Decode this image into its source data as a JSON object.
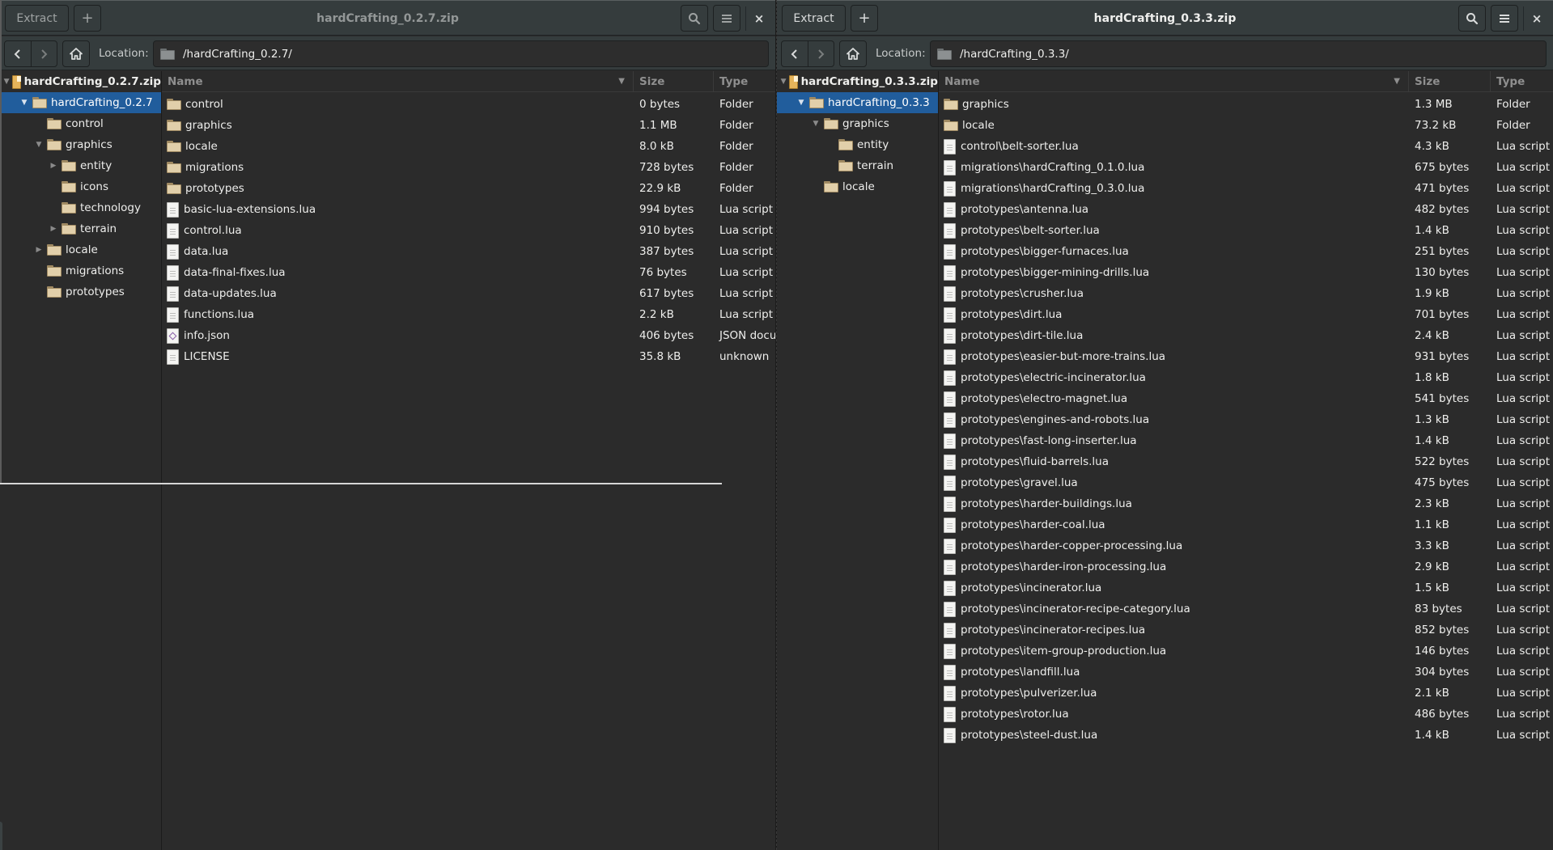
{
  "left_window": {
    "title": "hardCrafting_0.2.7.zip",
    "active": false,
    "toolbar": {
      "extract_label": "Extract",
      "add_label": "+",
      "search_icon": "search-icon",
      "menu_icon": "hamburger-menu-icon",
      "close_label": "×"
    },
    "location": {
      "label": "Location:",
      "path": "/hardCrafting_0.2.7/"
    },
    "tree": [
      {
        "label": "hardCrafting_0.2.7.zip",
        "depth": 0,
        "expander": "expanded",
        "icon": "archive-icon",
        "root": true
      },
      {
        "label": "hardCrafting_0.2.7",
        "depth": 1,
        "expander": "expanded",
        "icon": "folder-icon",
        "selected": true
      },
      {
        "label": "control",
        "depth": 2,
        "expander": "none",
        "icon": "folder-icon"
      },
      {
        "label": "graphics",
        "depth": 2,
        "expander": "expanded",
        "icon": "folder-icon"
      },
      {
        "label": "entity",
        "depth": 3,
        "expander": "collapsed",
        "icon": "folder-icon"
      },
      {
        "label": "icons",
        "depth": 3,
        "expander": "none",
        "icon": "folder-icon"
      },
      {
        "label": "technology",
        "depth": 3,
        "expander": "none",
        "icon": "folder-icon"
      },
      {
        "label": "terrain",
        "depth": 3,
        "expander": "collapsed",
        "icon": "folder-icon"
      },
      {
        "label": "locale",
        "depth": 2,
        "expander": "collapsed",
        "icon": "folder-icon"
      },
      {
        "label": "migrations",
        "depth": 2,
        "expander": "none",
        "icon": "folder-icon"
      },
      {
        "label": "prototypes",
        "depth": 2,
        "expander": "none",
        "icon": "folder-icon"
      }
    ],
    "columns": {
      "name": "Name",
      "size": "Size",
      "type": "Type"
    },
    "files": [
      {
        "name": "control",
        "size": "0 bytes",
        "type": "Folder",
        "icon": "folder"
      },
      {
        "name": "graphics",
        "size": "1.1 MB",
        "type": "Folder",
        "icon": "folder"
      },
      {
        "name": "locale",
        "size": "8.0 kB",
        "type": "Folder",
        "icon": "folder"
      },
      {
        "name": "migrations",
        "size": "728 bytes",
        "type": "Folder",
        "icon": "folder"
      },
      {
        "name": "prototypes",
        "size": "22.9 kB",
        "type": "Folder",
        "icon": "folder"
      },
      {
        "name": "basic-lua-extensions.lua",
        "size": "994 bytes",
        "type": "Lua script",
        "icon": "file"
      },
      {
        "name": "control.lua",
        "size": "910 bytes",
        "type": "Lua script",
        "icon": "file"
      },
      {
        "name": "data.lua",
        "size": "387 bytes",
        "type": "Lua script",
        "icon": "file"
      },
      {
        "name": "data-final-fixes.lua",
        "size": "76 bytes",
        "type": "Lua script",
        "icon": "file"
      },
      {
        "name": "data-updates.lua",
        "size": "617 bytes",
        "type": "Lua script",
        "icon": "file"
      },
      {
        "name": "functions.lua",
        "size": "2.2 kB",
        "type": "Lua script",
        "icon": "file"
      },
      {
        "name": "info.json",
        "size": "406 bytes",
        "type": "JSON document",
        "icon": "json"
      },
      {
        "name": "LICENSE",
        "size": "35.8 kB",
        "type": "unknown",
        "icon": "file"
      }
    ]
  },
  "right_window": {
    "title": "hardCrafting_0.3.3.zip",
    "active": true,
    "toolbar": {
      "extract_label": "Extract",
      "add_label": "+",
      "search_icon": "search-icon",
      "menu_icon": "hamburger-menu-icon",
      "close_label": "×"
    },
    "location": {
      "label": "Location:",
      "path": "/hardCrafting_0.3.3/"
    },
    "tree": [
      {
        "label": "hardCrafting_0.3.3.zip",
        "depth": 0,
        "expander": "expanded",
        "icon": "archive-icon",
        "root": true
      },
      {
        "label": "hardCrafting_0.3.3",
        "depth": 1,
        "expander": "expanded",
        "icon": "folder-icon",
        "selected": true
      },
      {
        "label": "graphics",
        "depth": 2,
        "expander": "expanded",
        "icon": "folder-icon"
      },
      {
        "label": "entity",
        "depth": 3,
        "expander": "none",
        "icon": "folder-icon"
      },
      {
        "label": "terrain",
        "depth": 3,
        "expander": "none",
        "icon": "folder-icon"
      },
      {
        "label": "locale",
        "depth": 2,
        "expander": "none",
        "icon": "folder-icon"
      }
    ],
    "columns": {
      "name": "Name",
      "size": "Size",
      "type": "Type"
    },
    "files": [
      {
        "name": "graphics",
        "size": "1.3 MB",
        "type": "Folder",
        "icon": "folder"
      },
      {
        "name": "locale",
        "size": "73.2 kB",
        "type": "Folder",
        "icon": "folder"
      },
      {
        "name": "control\\belt-sorter.lua",
        "size": "4.3 kB",
        "type": "Lua script",
        "icon": "file"
      },
      {
        "name": "migrations\\hardCrafting_0.1.0.lua",
        "size": "675 bytes",
        "type": "Lua script",
        "icon": "file"
      },
      {
        "name": "migrations\\hardCrafting_0.3.0.lua",
        "size": "471 bytes",
        "type": "Lua script",
        "icon": "file"
      },
      {
        "name": "prototypes\\antenna.lua",
        "size": "482 bytes",
        "type": "Lua script",
        "icon": "file"
      },
      {
        "name": "prototypes\\belt-sorter.lua",
        "size": "1.4 kB",
        "type": "Lua script",
        "icon": "file"
      },
      {
        "name": "prototypes\\bigger-furnaces.lua",
        "size": "251 bytes",
        "type": "Lua script",
        "icon": "file"
      },
      {
        "name": "prototypes\\bigger-mining-drills.lua",
        "size": "130 bytes",
        "type": "Lua script",
        "icon": "file"
      },
      {
        "name": "prototypes\\crusher.lua",
        "size": "1.9 kB",
        "type": "Lua script",
        "icon": "file"
      },
      {
        "name": "prototypes\\dirt.lua",
        "size": "701 bytes",
        "type": "Lua script",
        "icon": "file"
      },
      {
        "name": "prototypes\\dirt-tile.lua",
        "size": "2.4 kB",
        "type": "Lua script",
        "icon": "file"
      },
      {
        "name": "prototypes\\easier-but-more-trains.lua",
        "size": "931 bytes",
        "type": "Lua script",
        "icon": "file"
      },
      {
        "name": "prototypes\\electric-incinerator.lua",
        "size": "1.8 kB",
        "type": "Lua script",
        "icon": "file"
      },
      {
        "name": "prototypes\\electro-magnet.lua",
        "size": "541 bytes",
        "type": "Lua script",
        "icon": "file"
      },
      {
        "name": "prototypes\\engines-and-robots.lua",
        "size": "1.3 kB",
        "type": "Lua script",
        "icon": "file"
      },
      {
        "name": "prototypes\\fast-long-inserter.lua",
        "size": "1.4 kB",
        "type": "Lua script",
        "icon": "file"
      },
      {
        "name": "prototypes\\fluid-barrels.lua",
        "size": "522 bytes",
        "type": "Lua script",
        "icon": "file"
      },
      {
        "name": "prototypes\\gravel.lua",
        "size": "475 bytes",
        "type": "Lua script",
        "icon": "file"
      },
      {
        "name": "prototypes\\harder-buildings.lua",
        "size": "2.3 kB",
        "type": "Lua script",
        "icon": "file"
      },
      {
        "name": "prototypes\\harder-coal.lua",
        "size": "1.1 kB",
        "type": "Lua script",
        "icon": "file"
      },
      {
        "name": "prototypes\\harder-copper-processing.lua",
        "size": "3.3 kB",
        "type": "Lua script",
        "icon": "file"
      },
      {
        "name": "prototypes\\harder-iron-processing.lua",
        "size": "2.9 kB",
        "type": "Lua script",
        "icon": "file"
      },
      {
        "name": "prototypes\\incinerator.lua",
        "size": "1.5 kB",
        "type": "Lua script",
        "icon": "file"
      },
      {
        "name": "prototypes\\incinerator-recipe-category.lua",
        "size": "83 bytes",
        "type": "Lua script",
        "icon": "file"
      },
      {
        "name": "prototypes\\incinerator-recipes.lua",
        "size": "852 bytes",
        "type": "Lua script",
        "icon": "file"
      },
      {
        "name": "prototypes\\item-group-production.lua",
        "size": "146 bytes",
        "type": "Lua script",
        "icon": "file"
      },
      {
        "name": "prototypes\\landfill.lua",
        "size": "304 bytes",
        "type": "Lua script",
        "icon": "file"
      },
      {
        "name": "prototypes\\pulverizer.lua",
        "size": "2.1 kB",
        "type": "Lua script",
        "icon": "file"
      },
      {
        "name": "prototypes\\rotor.lua",
        "size": "486 bytes",
        "type": "Lua script",
        "icon": "file"
      },
      {
        "name": "prototypes\\steel-dust.lua",
        "size": "1.4 kB",
        "type": "Lua script",
        "icon": "file"
      }
    ]
  }
}
